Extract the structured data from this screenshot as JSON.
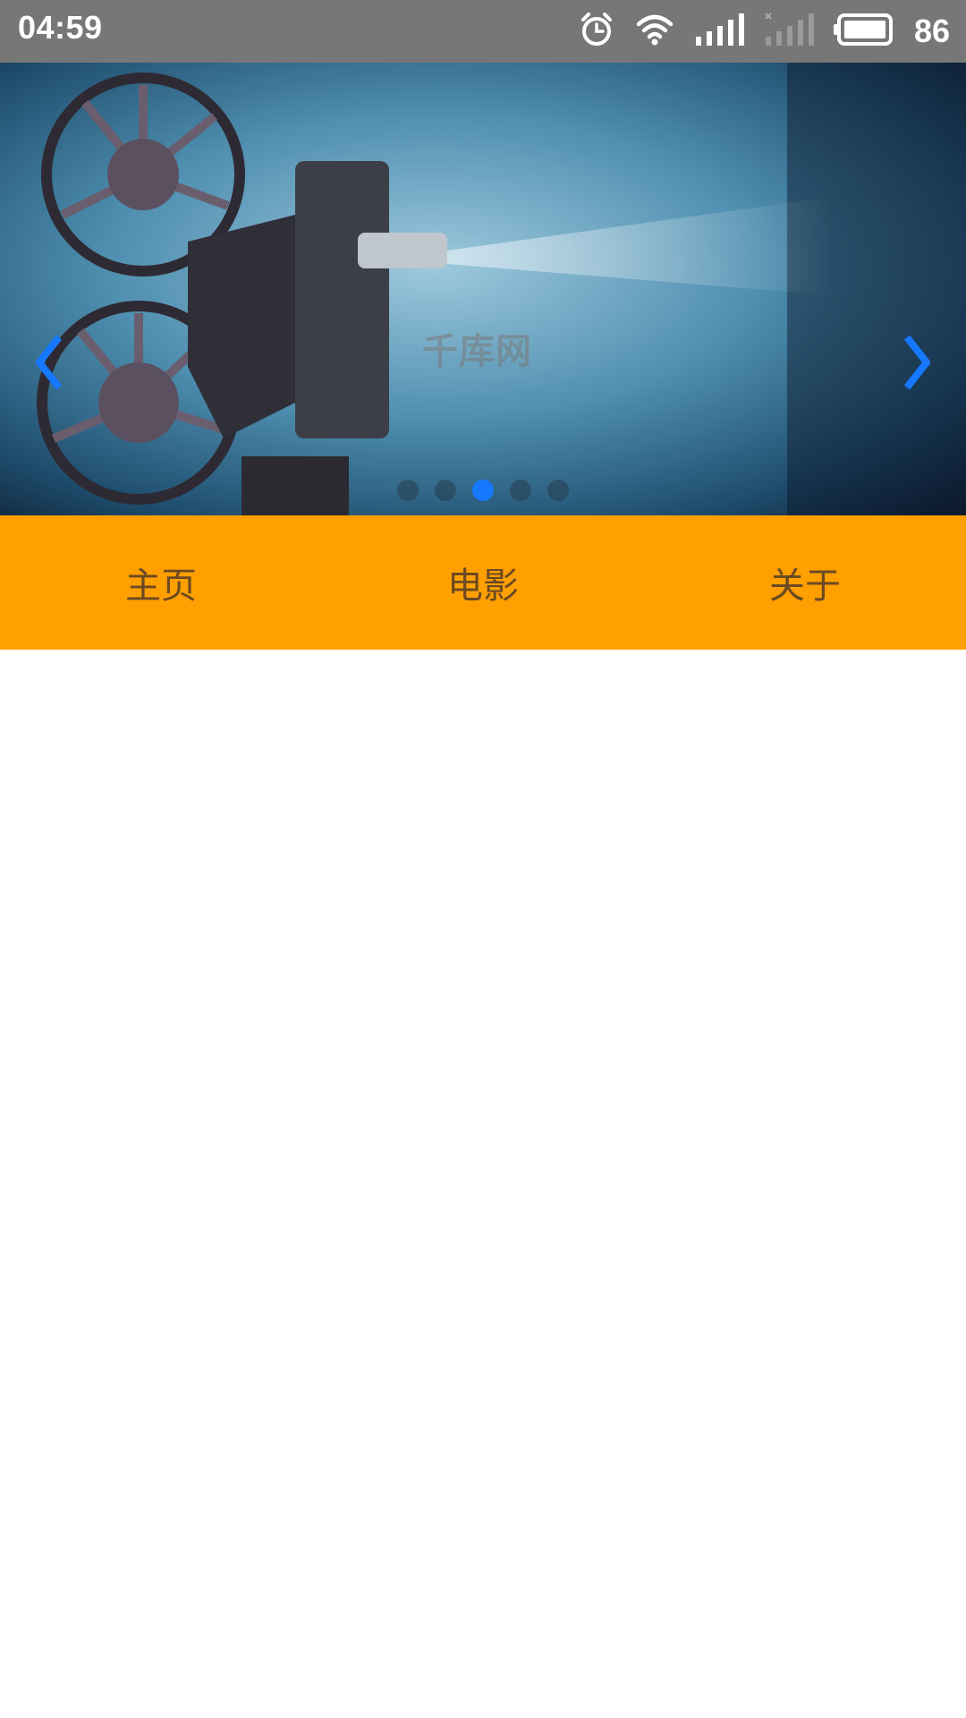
{
  "status_bar": {
    "time": "04:59",
    "battery_level": "86",
    "icons": [
      "alarm-icon",
      "wifi-icon",
      "signal-icon",
      "signal-no-sim-icon",
      "battery-icon"
    ]
  },
  "carousel": {
    "watermark": "千库网",
    "slide_count": 5,
    "active_index": 2,
    "prev_label": "❮",
    "next_label": "❯",
    "arrow_color": "#1677ff"
  },
  "nav": {
    "items": [
      {
        "label": "主页"
      },
      {
        "label": "电影"
      },
      {
        "label": "关于"
      }
    ],
    "background_color": "#ff9f00"
  }
}
